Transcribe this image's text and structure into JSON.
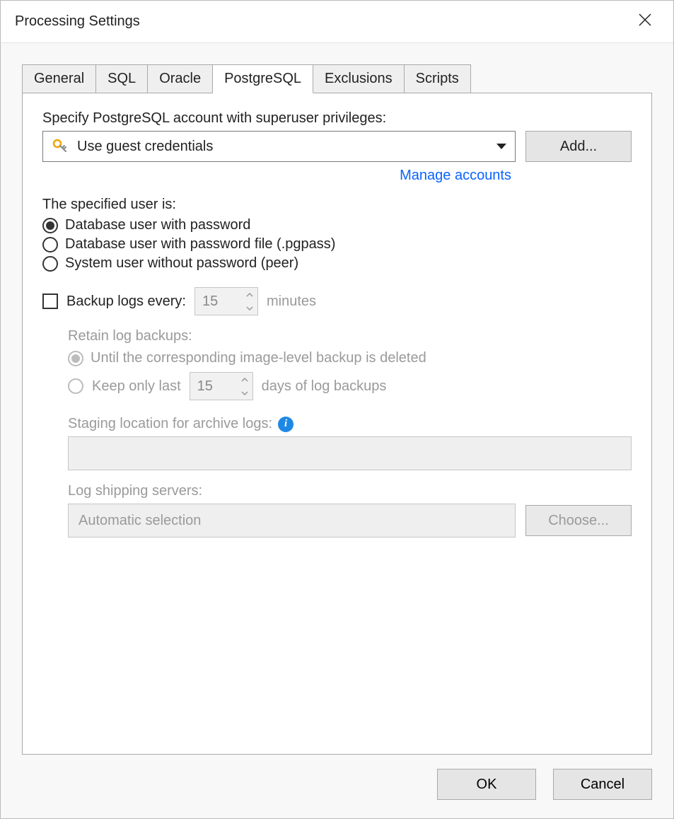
{
  "window": {
    "title": "Processing Settings"
  },
  "tabs": {
    "general": "General",
    "sql": "SQL",
    "oracle": "Oracle",
    "postgresql": "PostgreSQL",
    "exclusions": "Exclusions",
    "scripts": "Scripts",
    "active": "postgresql"
  },
  "postgresql": {
    "accountLabel": "Specify PostgreSQL account with superuser privileges:",
    "selectedAccount": "Use guest credentials",
    "addButton": "Add...",
    "manageLink": "Manage accounts",
    "userTypeLabel": "The specified user is:",
    "userTypeOptions": {
      "withPassword": "Database user with password",
      "withPgpass": "Database user with password file (.pgpass)",
      "peer": "System user without password (peer)"
    },
    "backupLogsLabel": "Backup logs every:",
    "backupLogsValue": "15",
    "backupLogsUnit": "minutes",
    "retainLabel": "Retain log backups:",
    "retainUntilDeleted": "Until the corresponding image-level backup is deleted",
    "keepOnlyLastPrefix": "Keep only last",
    "keepOnlyLastValue": "15",
    "keepOnlyLastSuffix": "days of log backups",
    "stagingLabel": "Staging location for archive logs:",
    "logShippingLabel": "Log shipping servers:",
    "logShippingValue": "Automatic selection",
    "chooseButton": "Choose..."
  },
  "footer": {
    "ok": "OK",
    "cancel": "Cancel"
  }
}
